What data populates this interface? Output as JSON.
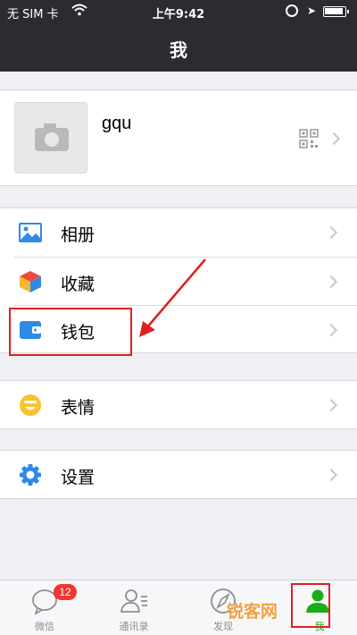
{
  "status_bar": {
    "carrier": "无 SIM 卡",
    "time": "上午9:42"
  },
  "nav": {
    "title": "我"
  },
  "profile": {
    "name": "gqu"
  },
  "menu": {
    "album": {
      "label": "相册",
      "icon": "album-icon"
    },
    "favorites": {
      "label": "收藏",
      "icon": "favorites-icon"
    },
    "wallet": {
      "label": "钱包",
      "icon": "wallet-icon"
    },
    "stickers": {
      "label": "表情",
      "icon": "sticker-icon"
    },
    "settings": {
      "label": "设置",
      "icon": "settings-icon"
    }
  },
  "tabs": [
    {
      "label": "微信",
      "badge": "12",
      "icon": "chat-icon"
    },
    {
      "label": "通讯录",
      "icon": "contacts-icon"
    },
    {
      "label": "发现",
      "icon": "compass-icon"
    },
    {
      "label": "我",
      "icon": "me-icon"
    }
  ],
  "watermark": {
    "text": "锐客网"
  },
  "colors": {
    "nav_bg": "#2b2b30",
    "accent_green": "#1aad19",
    "highlight_red": "#e02020",
    "badge_red": "#f43530"
  }
}
